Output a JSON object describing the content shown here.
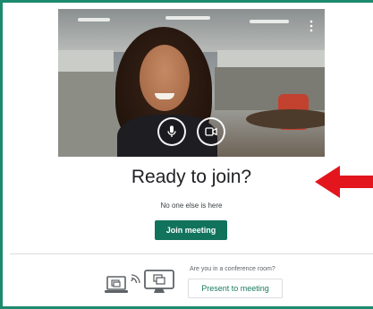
{
  "heading": "Ready to join?",
  "subheading": "No one else is here",
  "join_button": "Join meeting",
  "conference": {
    "prompt": "Are you in a conference room?",
    "button": "Present to meeting"
  },
  "icons": {
    "more": "more-vertical-icon",
    "mic": "microphone-icon",
    "camera": "camera-icon",
    "laptop": "laptop-cast-icon",
    "signal": "cast-signal-icon",
    "room_display": "room-display-icon",
    "pointer": "red-arrow-icon"
  },
  "colors": {
    "accent": "#12735d",
    "frame": "#1d8a6e",
    "arrow": "#e3161d",
    "text": "#202124"
  }
}
